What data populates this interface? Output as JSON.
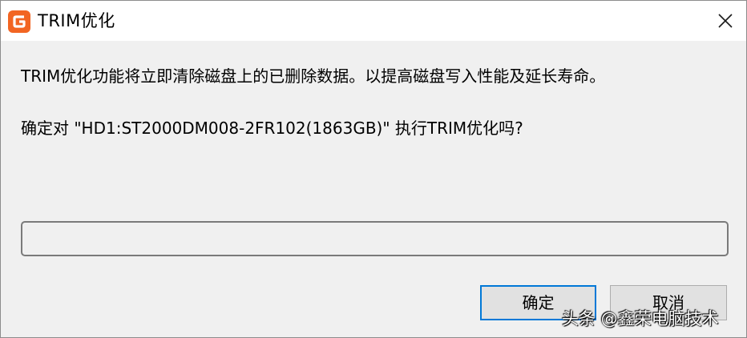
{
  "window": {
    "title": "TRIM优化",
    "icon": "app-logo-icon",
    "close_icon": "close-icon"
  },
  "message": {
    "line1": "TRIM优化功能将立即清除磁盘上的已删除数据。以提高磁盘写入性能及延长寿命。",
    "line2": "确定对 \"HD1:ST2000DM008-2FR102(1863GB)\" 执行TRIM优化吗?"
  },
  "input": {
    "value": ""
  },
  "buttons": {
    "ok_label": "确定",
    "cancel_label": "取消"
  },
  "watermark": "头条 @鑫荣电脑技术",
  "colors": {
    "accent": "#0078d7",
    "icon_orange": "#f26522",
    "dialog_bg": "#f0f0f0",
    "titlebar_bg": "#ffffff"
  }
}
